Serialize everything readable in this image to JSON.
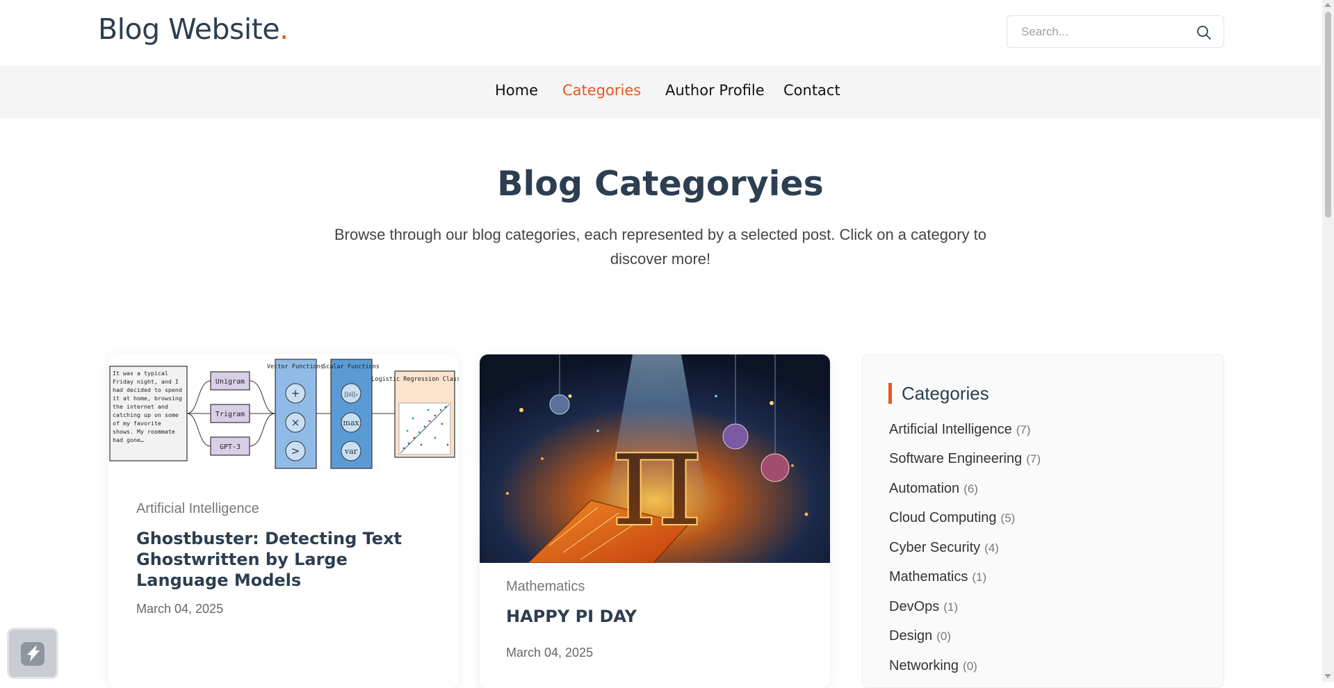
{
  "header": {
    "logo_text": "Blog Website",
    "logo_dot": ".",
    "search_placeholder": "Search...",
    "search_icon": "search-icon"
  },
  "nav": {
    "items": [
      {
        "label": "Home",
        "active": false
      },
      {
        "label": "Categories",
        "active": true
      },
      {
        "label": "Author Profile",
        "active": false
      },
      {
        "label": "Contact",
        "active": false
      }
    ]
  },
  "hero": {
    "title": "Blog Categoryies",
    "subtitle": "Browse through our blog categories, each represented by a selected post. Click on a category to discover more!"
  },
  "cards": [
    {
      "category": "Artificial Intelligence",
      "title": "Ghostbuster: Detecting Text Ghostwritten by Large Language Models",
      "date": "March 04, 2025",
      "image": {
        "sample_text": "It was a typical Friday night, and I had decided to spend it at home, browsing the internet and catching up on some of my favorite shows. My roommate had gone…",
        "ngram_labels": [
          "Unigram",
          "Trigram",
          "GPT-3"
        ],
        "vector_label": "Vector Functions",
        "vector_ops": [
          "+",
          "×",
          ">"
        ],
        "scalar_label": "Scalar Functions",
        "scalar_ops": [
          "||z||₂",
          "max",
          "var"
        ],
        "classifier_label": "Logistic Regression Classifier"
      }
    },
    {
      "category": "Mathematics",
      "title": "HAPPY PI DAY",
      "date": "March 04, 2025",
      "image": {
        "symbol": "π"
      }
    }
  ],
  "sidebar": {
    "title": "Categories",
    "items": [
      {
        "label": "Artificial Intelligence",
        "count": "(7)"
      },
      {
        "label": "Software Engineering",
        "count": "(7)"
      },
      {
        "label": "Automation",
        "count": "(6)"
      },
      {
        "label": "Cloud Computing",
        "count": "(5)"
      },
      {
        "label": "Cyber Security",
        "count": "(4)"
      },
      {
        "label": "Mathematics",
        "count": "(1)"
      },
      {
        "label": "DevOps",
        "count": "(1)"
      },
      {
        "label": "Design",
        "count": "(0)"
      },
      {
        "label": "Networking",
        "count": "(0)"
      }
    ]
  },
  "colors": {
    "accent": "#e8571e",
    "heading": "#2c3e50",
    "nav_bg": "#f5f5f5"
  }
}
